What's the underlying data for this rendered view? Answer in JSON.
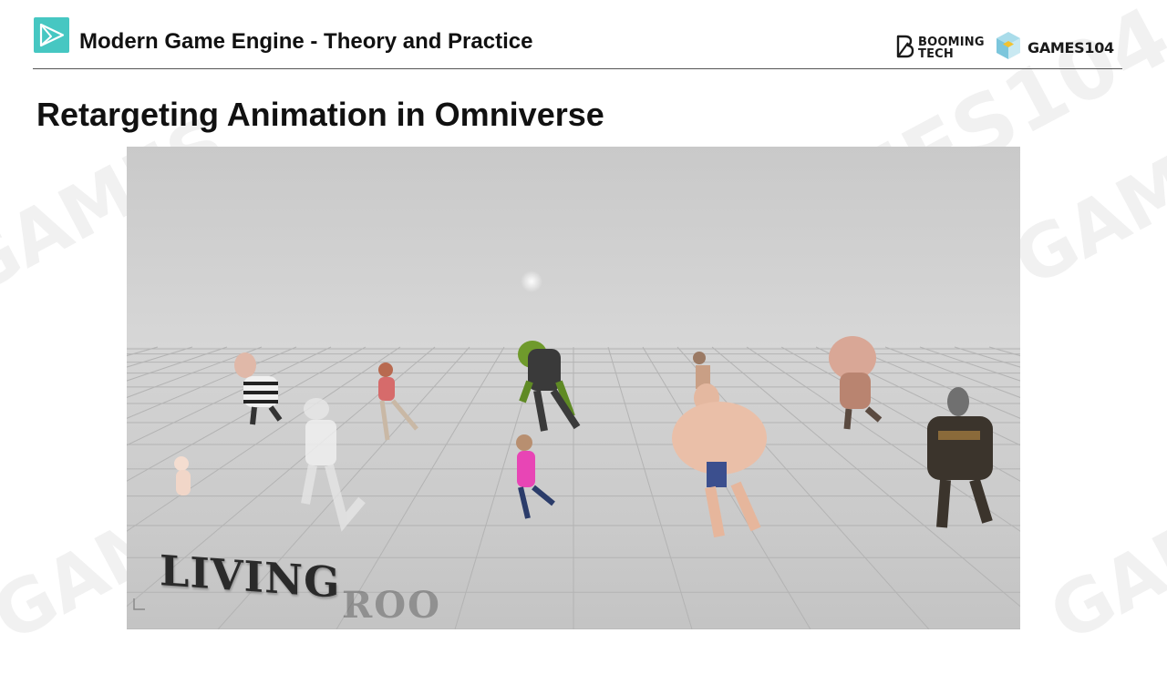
{
  "header": {
    "title": "Modern Game Engine - Theory and Practice",
    "brand_booming_line1": "BOOMING",
    "brand_booming_line2": "TECH",
    "brand_games": "GAMES104"
  },
  "slide": {
    "title": "Retargeting Animation in Omniverse"
  },
  "video": {
    "overlay_text": "LIVING",
    "overlay_text_partial": "ROO"
  },
  "colors": {
    "accent": "#46c7c2",
    "rule": "#555555",
    "video_bg": "#d2d2d2"
  },
  "icons": {
    "header_logo": "play-triangle-icon",
    "booming_logo": "booming-tech-logo-icon",
    "games_logo": "games-cube-icon"
  }
}
